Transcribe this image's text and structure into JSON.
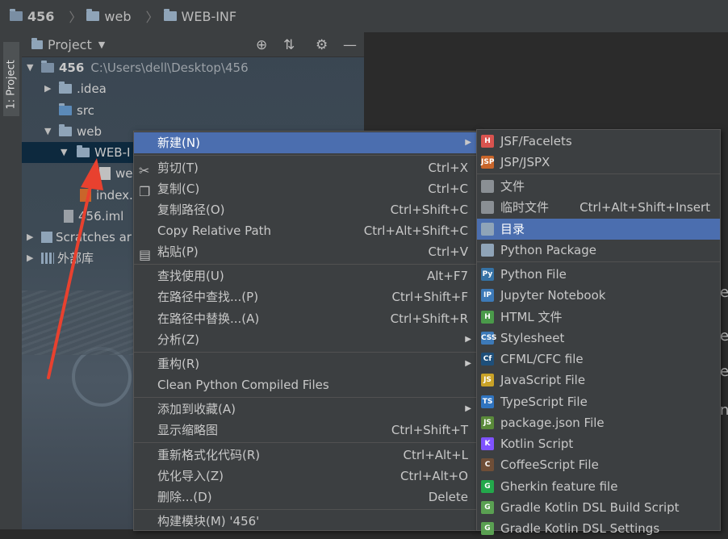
{
  "breadcrumb": {
    "items": [
      "456",
      "web",
      "WEB-INF"
    ]
  },
  "tool_window": {
    "tab_label": "1: Project",
    "title": "Project"
  },
  "tree": [
    {
      "label": "456",
      "path": "C:\\Users\\dell\\Desktop\\456"
    },
    {
      "label": ".idea"
    },
    {
      "label": "src"
    },
    {
      "label": "web"
    },
    {
      "label": "WEB-I"
    },
    {
      "label": "we"
    },
    {
      "label": "index."
    },
    {
      "label": "456.iml"
    },
    {
      "label": "Scratches ar"
    },
    {
      "label": "外部库"
    }
  ],
  "context_menu": [
    {
      "label": "新建(N)",
      "shortcut": "",
      "submenu": true
    },
    {
      "label": "剪切(T)",
      "shortcut": "Ctrl+X"
    },
    {
      "label": "复制(C)",
      "shortcut": "Ctrl+C"
    },
    {
      "label": "复制路径(O)",
      "shortcut": "Ctrl+Shift+C"
    },
    {
      "label": "Copy Relative Path",
      "shortcut": "Ctrl+Alt+Shift+C"
    },
    {
      "label": "粘贴(P)",
      "shortcut": "Ctrl+V"
    },
    {
      "label": "查找使用(U)",
      "shortcut": "Alt+F7"
    },
    {
      "label": "在路径中查找...(P)",
      "shortcut": "Ctrl+Shift+F"
    },
    {
      "label": "在路径中替换...(A)",
      "shortcut": "Ctrl+Shift+R"
    },
    {
      "label": "分析(Z)",
      "shortcut": "",
      "submenu": true
    },
    {
      "label": "重构(R)",
      "shortcut": "",
      "submenu": true
    },
    {
      "label": "Clean Python Compiled Files",
      "shortcut": ""
    },
    {
      "label": "添加到收藏(A)",
      "shortcut": "",
      "submenu": true
    },
    {
      "label": "显示缩略图",
      "shortcut": "Ctrl+Shift+T"
    },
    {
      "label": "重新格式化代码(R)",
      "shortcut": "Ctrl+Alt+L"
    },
    {
      "label": "优化导入(Z)",
      "shortcut": "Ctrl+Alt+O"
    },
    {
      "label": "删除...(D)",
      "shortcut": "Delete"
    },
    {
      "label": "构建模块(M) '456'",
      "shortcut": ""
    }
  ],
  "new_submenu": [
    {
      "label": "JSF/Facelets",
      "shortcut": "",
      "icon": "jsf-file-icon",
      "badge": "H",
      "color": "#d9534f"
    },
    {
      "label": "JSP/JSPX",
      "shortcut": "",
      "icon": "jsp-file-icon",
      "badge": "JSP",
      "color": "#c9652a"
    },
    {
      "label": "文件",
      "shortcut": "",
      "icon": "file-icon",
      "badge": "",
      "color": "#8a8f94"
    },
    {
      "label": "临时文件",
      "shortcut": "Ctrl+Alt+Shift+Insert",
      "icon": "scratch-file-icon",
      "badge": "",
      "color": "#8a8f94"
    },
    {
      "label": "目录",
      "shortcut": "",
      "icon": "directory-icon",
      "badge": "",
      "color": "#8fa4b8"
    },
    {
      "label": "Python Package",
      "shortcut": "",
      "icon": "python-package-icon",
      "badge": "",
      "color": "#8fa4b8"
    },
    {
      "label": "Python File",
      "shortcut": "",
      "icon": "python-file-icon",
      "badge": "Py",
      "color": "#3572a5"
    },
    {
      "label": "Jupyter Notebook",
      "shortcut": "",
      "icon": "jupyter-notebook-icon",
      "badge": "IP",
      "color": "#3d7ab8"
    },
    {
      "label": "HTML 文件",
      "shortcut": "",
      "icon": "html-file-icon",
      "badge": "H",
      "color": "#4a9a4a"
    },
    {
      "label": "Stylesheet",
      "shortcut": "",
      "icon": "css-file-icon",
      "badge": "CSS",
      "color": "#3d7ab8"
    },
    {
      "label": "CFML/CFC file",
      "shortcut": "",
      "icon": "cfml-file-icon",
      "badge": "Cf",
      "color": "#1e4f7a"
    },
    {
      "label": "JavaScript File",
      "shortcut": "",
      "icon": "javascript-file-icon",
      "badge": "JS",
      "color": "#c9a227"
    },
    {
      "label": "TypeScript File",
      "shortcut": "",
      "icon": "typescript-file-icon",
      "badge": "TS",
      "color": "#2f74c0"
    },
    {
      "label": "package.json File",
      "shortcut": "",
      "icon": "package-json-icon",
      "badge": "JS",
      "color": "#5a8a3a"
    },
    {
      "label": "Kotlin Script",
      "shortcut": "",
      "icon": "kotlin-script-icon",
      "badge": "K",
      "color": "#7f52ff"
    },
    {
      "label": "CoffeeScript File",
      "shortcut": "",
      "icon": "coffeescript-file-icon",
      "badge": "C",
      "color": "#6f4e37"
    },
    {
      "label": "Gherkin feature file",
      "shortcut": "",
      "icon": "gherkin-feature-icon",
      "badge": "G",
      "color": "#23a84b"
    },
    {
      "label": "Gradle Kotlin DSL Build Script",
      "shortcut": "",
      "icon": "gradle-kotlin-icon",
      "badge": "G",
      "color": "#5aa052"
    },
    {
      "label": "Gradle Kotlin DSL Settings",
      "shortcut": "",
      "icon": "gradle-kotlin-settings-icon",
      "badge": "G",
      "color": "#5aa052"
    }
  ],
  "editor_chars": [
    "e",
    "e",
    "e",
    "n"
  ]
}
